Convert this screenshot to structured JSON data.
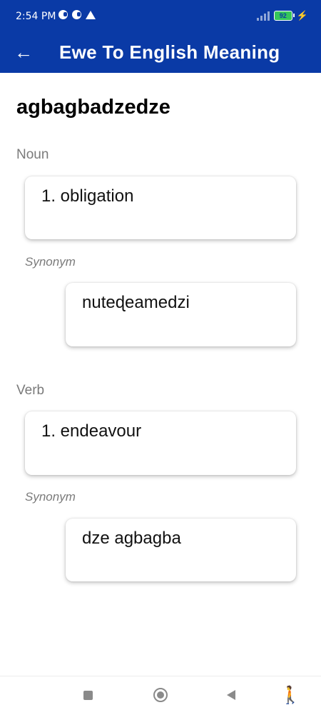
{
  "status": {
    "time": "2:54 PM",
    "battery": "92"
  },
  "appbar": {
    "title": "Ewe To English Meaning"
  },
  "entry": {
    "word": "agbagbadzedze",
    "sections": [
      {
        "pos": "Noun",
        "meaning": "1. obligation",
        "synonym_label": "Synonym",
        "synonym": "nuteɖeamedzi"
      },
      {
        "pos": "Verb",
        "meaning": "1. endeavour",
        "synonym_label": "Synonym",
        "synonym": "dze agbagba"
      }
    ]
  },
  "colors": {
    "appbar": "#0a3aa6",
    "text_secondary": "#7a7a7a"
  },
  "icons": {
    "back": "arrow-left",
    "nav": [
      "recents-square",
      "home-circle",
      "back-triangle",
      "accessibility-person"
    ]
  }
}
